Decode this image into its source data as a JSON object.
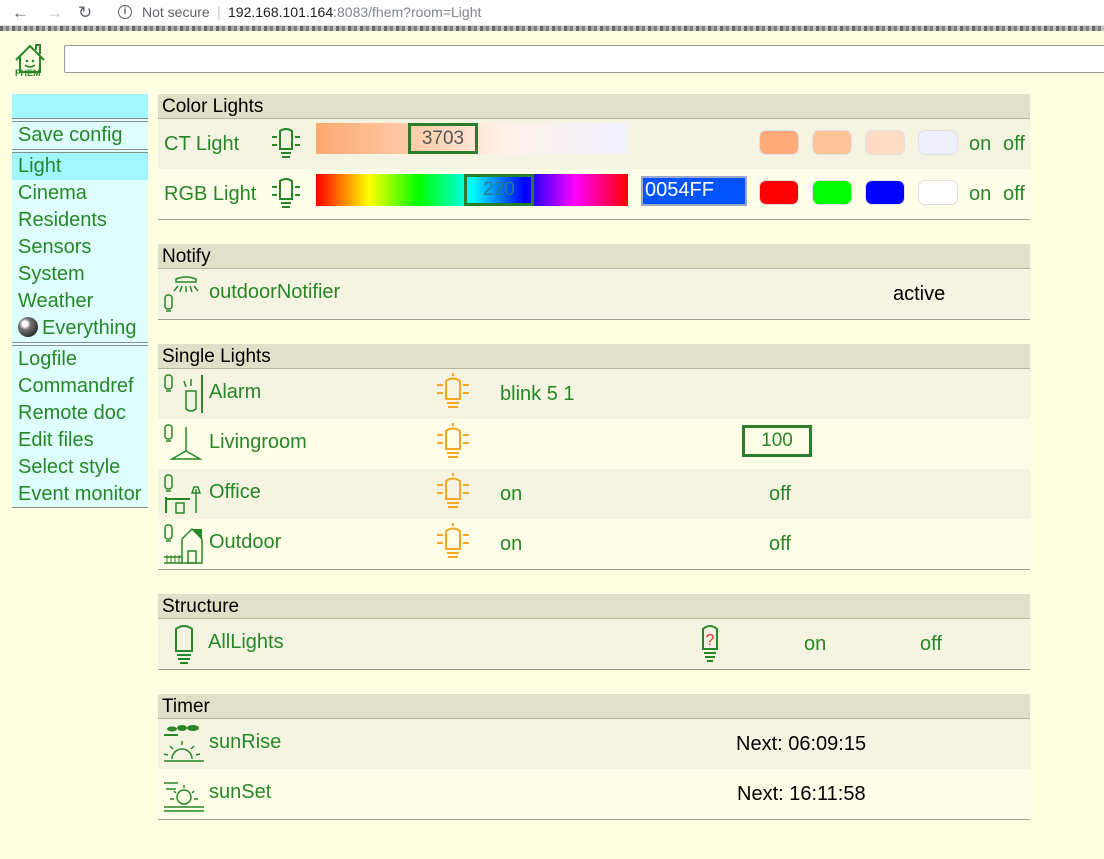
{
  "browser": {
    "security": "Not secure",
    "url_host": "192.168.101.164",
    "url_rest": ":8083/fhem?room=Light"
  },
  "logo": {
    "text": "FHEM"
  },
  "menu": {
    "items": [
      {
        "label": "Save config"
      },
      {
        "label": "Light"
      },
      {
        "label": "Cinema"
      },
      {
        "label": "Residents"
      },
      {
        "label": "Sensors"
      },
      {
        "label": "System"
      },
      {
        "label": "Weather"
      },
      {
        "label": "Everything"
      },
      {
        "label": "Logfile"
      },
      {
        "label": "Commandref"
      },
      {
        "label": "Remote doc"
      },
      {
        "label": "Edit files"
      },
      {
        "label": "Select style"
      },
      {
        "label": "Event monitor"
      }
    ]
  },
  "sections": {
    "color_lights": {
      "title": "Color Lights",
      "ct": {
        "name": "CT Light",
        "value": "3703",
        "on": "on",
        "off": "off",
        "swatches": [
          "#ffaa78",
          "#ffc39a",
          "#ffdcc4",
          "#eef0fc"
        ]
      },
      "rgb": {
        "name": "RGB Light",
        "hue": "220",
        "hex": "0054FF",
        "on": "on",
        "off": "off",
        "swatches": [
          "#ff0000",
          "#00ff00",
          "#0000ff",
          "#ffffff"
        ]
      }
    },
    "notify": {
      "title": "Notify",
      "name": "outdoorNotifier",
      "state": "active"
    },
    "single": {
      "title": "Single Lights",
      "alarm": {
        "name": "Alarm",
        "cmd": "blink 5 1"
      },
      "livingroom": {
        "name": "Livingroom",
        "value": "100"
      },
      "office": {
        "name": "Office",
        "on": "on",
        "off": "off"
      },
      "outdoor": {
        "name": "Outdoor",
        "on": "on",
        "off": "off"
      }
    },
    "structure": {
      "title": "Structure",
      "name": "AllLights",
      "on": "on",
      "off": "off"
    },
    "timer": {
      "title": "Timer",
      "sunrise": {
        "name": "sunRise",
        "next": "Next: 06:09:15"
      },
      "sunset": {
        "name": "sunSet",
        "next": "Next: 16:11:58"
      }
    }
  }
}
